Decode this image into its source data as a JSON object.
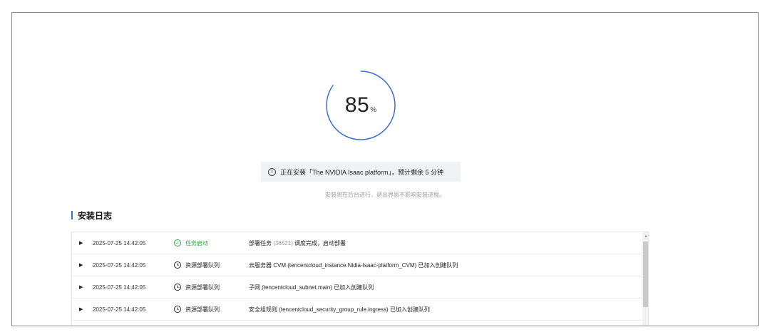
{
  "progress": {
    "value": "85",
    "unit": "%"
  },
  "banner": {
    "icon": "info-icon",
    "text": "正在安装「The NVIDIA Isaac platform」，预计剩余 5 分钟"
  },
  "note": "安装将在后台进行，退出界面不影响安装进程。",
  "log": {
    "title": "安装日志",
    "rows": [
      {
        "time": "2025-07-25 14:42:05",
        "status": "任务启动",
        "status_kind": "ok",
        "msg_a": "部署任务 ",
        "msg_muted": "(36621)",
        "msg_b": " 调度完成，启动部署"
      },
      {
        "time": "2025-07-25 14:42:05",
        "status": "资源部署队列",
        "status_kind": "pending",
        "msg_a": "云服务器 CVM (tencentcloud_instance.Nidia-Isaac-platform_CVM) 已加入创建队列",
        "msg_muted": "",
        "msg_b": ""
      },
      {
        "time": "2025-07-25 14:42:05",
        "status": "资源部署队列",
        "status_kind": "pending",
        "msg_a": "子网 (tencentcloud_subnet.main) 已加入创建队列",
        "msg_muted": "",
        "msg_b": ""
      },
      {
        "time": "2025-07-25 14:42:05",
        "status": "资源部署队列",
        "status_kind": "pending",
        "msg_a": "安全组规则 (tencentcloud_security_group_rule.ingress) 已加入创建队列",
        "msg_muted": "",
        "msg_b": ""
      }
    ]
  },
  "colors": {
    "accent": "#2f6fe0",
    "ring": "#3a6fd8",
    "success": "#2ea44f"
  }
}
